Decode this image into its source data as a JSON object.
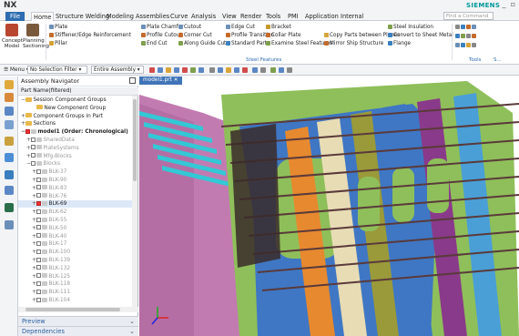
{
  "app": {
    "name": "NX",
    "brand": "SIEMENS"
  },
  "menu": {
    "items": [
      "File",
      "Home",
      "Structure Welding",
      "Modeling",
      "Assemblies",
      "Curve",
      "Analysis",
      "View",
      "Render",
      "Tools",
      "PMI",
      "Application",
      "Internal"
    ],
    "search_placeholder": "Find a Command"
  },
  "ribbon": {
    "big_buttons": [
      "Concept Model",
      "Planning Sectioning"
    ],
    "col1": [
      "Plate",
      "Stiffener/Edge Reinforcement",
      "Pillar"
    ],
    "col2": [
      "Plate Chamfer",
      "Profile Cutout",
      "End Cut"
    ],
    "col3": [
      "Cutout",
      "Corner Cut",
      "Along Guide Cut"
    ],
    "col4": [
      "Edge Cut",
      "Profile Transition",
      "Standard Part"
    ],
    "col5": [
      "Bracket",
      "Collar Plate",
      "Examine Steel Features"
    ],
    "col6": [
      "Copy Parts between Planes",
      "Mirror Ship Structure"
    ],
    "col7": [
      "Steel Insulation",
      "Convert to Sheet Metal",
      "Flange"
    ],
    "group_label": "Steel Features",
    "tools_label": "Tools",
    "more_label": "S..."
  },
  "toolbar": {
    "menu_label": "Menu",
    "filter": "No Selection Filter",
    "scope": "Entire Assembly"
  },
  "navigator": {
    "title": "Assembly Navigator",
    "column": "Part Name(filtered)",
    "rows": [
      {
        "label": "Session Component Groups",
        "indent": 0,
        "exp": "-",
        "kind": "fold",
        "style": ""
      },
      {
        "label": "New Component Group",
        "indent": 2,
        "exp": "",
        "kind": "fold",
        "style": ""
      },
      {
        "label": "Component Groups in Part",
        "indent": 0,
        "exp": "+",
        "kind": "fold",
        "style": ""
      },
      {
        "label": "Sections",
        "indent": 0,
        "exp": "+",
        "kind": "fold",
        "style": ""
      },
      {
        "label": "model1 (Order: Chronological)",
        "indent": 0,
        "exp": "-",
        "kind": "chkon",
        "style": "bold"
      },
      {
        "label": "SharedData",
        "indent": 1,
        "exp": "+",
        "kind": "chk",
        "style": "dim"
      },
      {
        "label": "PlateSystems",
        "indent": 1,
        "exp": "+",
        "kind": "chk",
        "style": "dim"
      },
      {
        "label": "Mfg-Blocks",
        "indent": 1,
        "exp": "+",
        "kind": "chk",
        "style": "dim"
      },
      {
        "label": "Blocks",
        "indent": 1,
        "exp": "-",
        "kind": "chk",
        "style": "dim"
      },
      {
        "label": "BLK-37",
        "indent": 2,
        "exp": "+",
        "kind": "chk",
        "style": "dim"
      },
      {
        "label": "BLK-90",
        "indent": 2,
        "exp": "+",
        "kind": "chk",
        "style": "dim"
      },
      {
        "label": "BLK-83",
        "indent": 2,
        "exp": "+",
        "kind": "chk",
        "style": "dim"
      },
      {
        "label": "BLK-76",
        "indent": 2,
        "exp": "+",
        "kind": "chk",
        "style": "dim"
      },
      {
        "label": "BLK-69",
        "indent": 2,
        "exp": "+",
        "kind": "chkon",
        "style": "sel"
      },
      {
        "label": "BLK-62",
        "indent": 2,
        "exp": "+",
        "kind": "chk",
        "style": "dim"
      },
      {
        "label": "BLK-55",
        "indent": 2,
        "exp": "+",
        "kind": "chk",
        "style": "dim"
      },
      {
        "label": "BLK-50",
        "indent": 2,
        "exp": "+",
        "kind": "chk",
        "style": "dim"
      },
      {
        "label": "BLK-40",
        "indent": 2,
        "exp": "+",
        "kind": "chk",
        "style": "dim"
      },
      {
        "label": "BLK-17",
        "indent": 2,
        "exp": "+",
        "kind": "chk",
        "style": "dim"
      },
      {
        "label": "BLK-100",
        "indent": 2,
        "exp": "+",
        "kind": "chk",
        "style": "dim"
      },
      {
        "label": "BLK-139",
        "indent": 2,
        "exp": "+",
        "kind": "chk",
        "style": "dim"
      },
      {
        "label": "BLK-132",
        "indent": 2,
        "exp": "+",
        "kind": "chk",
        "style": "dim"
      },
      {
        "label": "BLK-125",
        "indent": 2,
        "exp": "+",
        "kind": "chk",
        "style": "dim"
      },
      {
        "label": "BLK-118",
        "indent": 2,
        "exp": "+",
        "kind": "chk",
        "style": "dim"
      },
      {
        "label": "BLK-111",
        "indent": 2,
        "exp": "+",
        "kind": "chk",
        "style": "dim"
      },
      {
        "label": "BLK-104",
        "indent": 2,
        "exp": "+",
        "kind": "chk",
        "style": "dim"
      }
    ],
    "panels": [
      "Preview",
      "Dependencies"
    ]
  },
  "graphics": {
    "tab": "model1.prt"
  },
  "colors": {
    "accent": "#2d6db0",
    "brand": "#009999",
    "hull_pink": "#c27bb0",
    "deck_cyan": "#33c8d6",
    "frame_green": "#8fbf5a",
    "bulkhead_blue": "#3f77c4",
    "web_orange": "#e7892f",
    "web_cream": "#e8dcb5",
    "web_olive": "#9a9a3a",
    "stiffener_dark": "#5a3a3a"
  }
}
